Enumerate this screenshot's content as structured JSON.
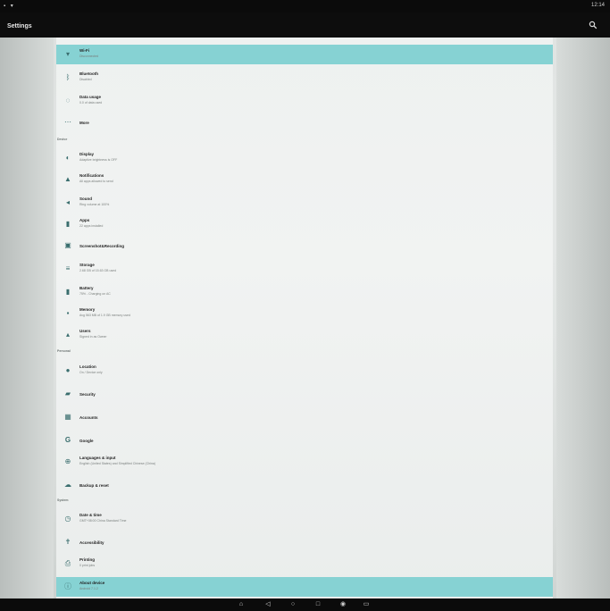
{
  "status_bar": {
    "left_icons": "▪ ▾",
    "time": "12:14"
  },
  "toolbar": {
    "title": "Settings",
    "search_icon": "search-icon"
  },
  "sections": {
    "device": "Device",
    "personal": "Personal",
    "system": "System"
  },
  "items": [
    {
      "id": "wifi",
      "title": "Wi-Fi",
      "subtitle": "Disconnected",
      "icon": "wifi-icon",
      "glyph": "▾",
      "highlight": true
    },
    {
      "id": "bluetooth",
      "title": "Bluetooth",
      "subtitle": "Disabled",
      "icon": "bluetooth-icon",
      "glyph": "ᛒ"
    },
    {
      "id": "data-usage",
      "title": "Data usage",
      "subtitle": "0.0 of data used",
      "icon": "data-usage-icon",
      "glyph": "◌"
    },
    {
      "id": "more",
      "title": "More",
      "subtitle": "",
      "icon": "more-icon",
      "glyph": "⋯"
    },
    {
      "id": "display",
      "title": "Display",
      "subtitle": "Adaptive brightness is OFF",
      "icon": "display-icon",
      "glyph": "◐"
    },
    {
      "id": "notifications",
      "title": "Notifications",
      "subtitle": "All apps allowed to send",
      "icon": "bell-icon",
      "glyph": "▲"
    },
    {
      "id": "sound",
      "title": "Sound",
      "subtitle": "Ring volume at 100%",
      "icon": "volume-icon",
      "glyph": "◂"
    },
    {
      "id": "apps",
      "title": "Apps",
      "subtitle": "22 apps installed",
      "icon": "apps-icon",
      "glyph": "▮"
    },
    {
      "id": "screenshot",
      "title": "Screenshot&Recording",
      "subtitle": "",
      "icon": "screenshot-icon",
      "glyph": "▣"
    },
    {
      "id": "storage",
      "title": "Storage",
      "subtitle": "2.68 GB of 15.63 GB used",
      "icon": "storage-icon",
      "glyph": "≡"
    },
    {
      "id": "battery",
      "title": "Battery",
      "subtitle": "75% - Charging on AC",
      "icon": "battery-icon",
      "glyph": "▮"
    },
    {
      "id": "memory",
      "title": "Memory",
      "subtitle": "Avg 563 MB of 1.9 GB memory used",
      "icon": "memory-icon",
      "glyph": "▪"
    },
    {
      "id": "users",
      "title": "Users",
      "subtitle": "Signed in as Owner",
      "icon": "user-icon",
      "glyph": "▴"
    },
    {
      "id": "location",
      "title": "Location",
      "subtitle": "On / Device only",
      "icon": "location-icon",
      "glyph": "●"
    },
    {
      "id": "security",
      "title": "Security",
      "subtitle": "",
      "icon": "lock-icon",
      "glyph": "▰"
    },
    {
      "id": "accounts",
      "title": "Accounts",
      "subtitle": "",
      "icon": "accounts-icon",
      "glyph": "▦"
    },
    {
      "id": "google",
      "title": "Google",
      "subtitle": "",
      "icon": "google-icon",
      "glyph": "G"
    },
    {
      "id": "languages",
      "title": "Languages & input",
      "subtitle": "English (United States) and Simplified Chinese (China)",
      "icon": "language-icon",
      "glyph": "⊕"
    },
    {
      "id": "backup",
      "title": "Backup & reset",
      "subtitle": "",
      "icon": "backup-icon",
      "glyph": "☁"
    },
    {
      "id": "datetime",
      "title": "Date & time",
      "subtitle": "GMT+08:00 China Standard Time",
      "icon": "clock-icon",
      "glyph": "◷"
    },
    {
      "id": "accessibility",
      "title": "Accessibility",
      "subtitle": "",
      "icon": "accessibility-icon",
      "glyph": "✝"
    },
    {
      "id": "printing",
      "title": "Printing",
      "subtitle": "0 print jobs",
      "icon": "print-icon",
      "glyph": "⎙"
    },
    {
      "id": "about",
      "title": "About device",
      "subtitle": "Android 7.1.2",
      "icon": "info-icon",
      "glyph": "ⓘ",
      "highlight": true
    }
  ],
  "nav": {
    "home_glyph": "⌂",
    "back_glyph": "◁",
    "circle_glyph": "○",
    "recents_glyph": "□",
    "camera_glyph": "◉",
    "keyboard_glyph": "▭"
  },
  "colors": {
    "accent": "#86d2d3",
    "icon": "#3a6e6e",
    "background": "#eef1f0"
  }
}
